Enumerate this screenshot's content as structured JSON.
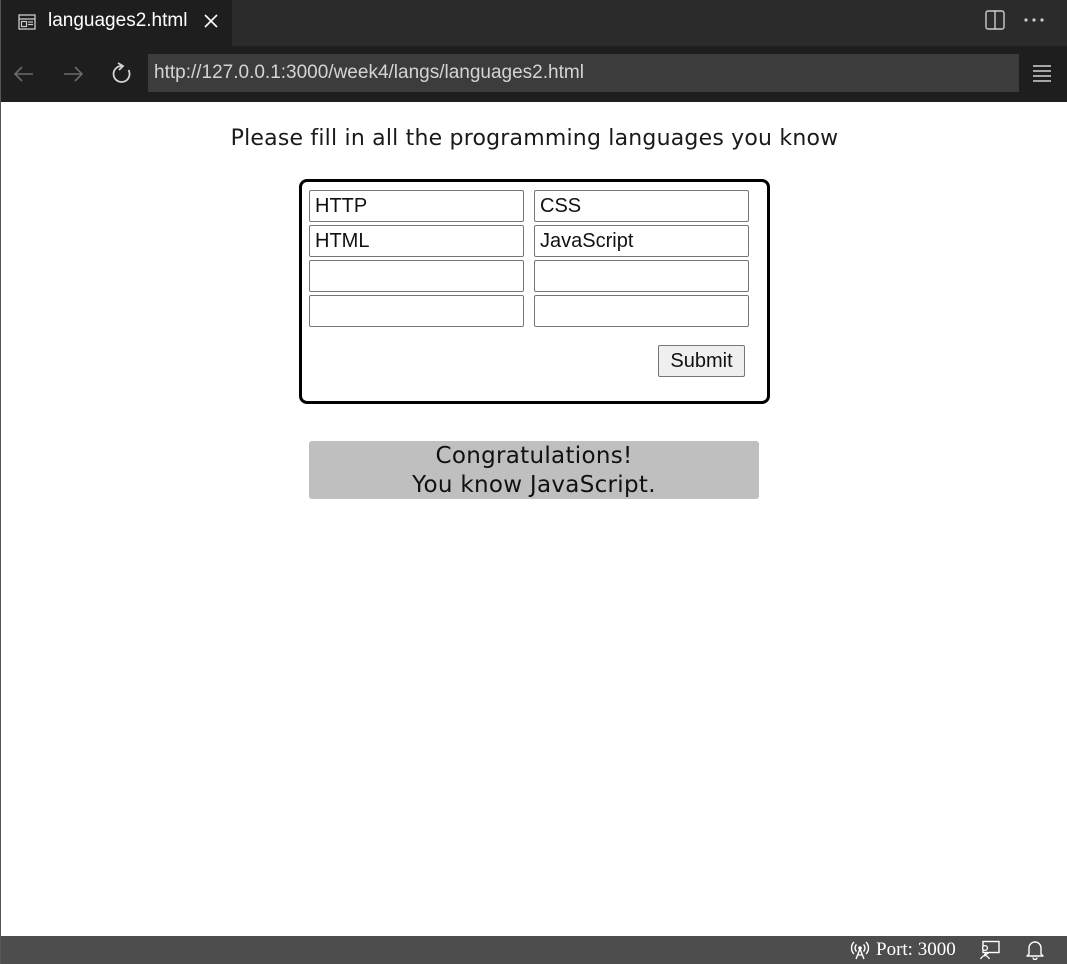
{
  "tab": {
    "title": "languages2.html"
  },
  "address_bar": {
    "url": "http://127.0.0.1:3000/week4/langs/languages2.html"
  },
  "page": {
    "heading": "Please fill in all the programming languages you know",
    "inputs": [
      {
        "value": "HTTP"
      },
      {
        "value": "CSS"
      },
      {
        "value": "HTML"
      },
      {
        "value": "JavaScript"
      },
      {
        "value": ""
      },
      {
        "value": ""
      },
      {
        "value": ""
      },
      {
        "value": ""
      }
    ],
    "submit_label": "Submit",
    "result": {
      "line1": "Congratulations!",
      "line2": "You know JavaScript."
    }
  },
  "status_bar": {
    "port_label": "Port: 3000"
  },
  "colors": {
    "tab_bar": "#2b2b2b",
    "nav_bar": "#1e1e1e",
    "url_field": "#3c3c3c",
    "status_bar": "#4d4d4d",
    "result_box": "#bfbfbf"
  },
  "icons": {
    "tab": "preview-icon",
    "close": "close-icon",
    "split": "split-editor-icon",
    "more": "more-actions-icon",
    "back": "arrow-left-icon",
    "forward": "arrow-right-icon",
    "reload": "reload-icon",
    "menu": "menu-icon",
    "port": "broadcast-icon",
    "feedback": "feedback-icon",
    "notifications": "bell-icon"
  }
}
